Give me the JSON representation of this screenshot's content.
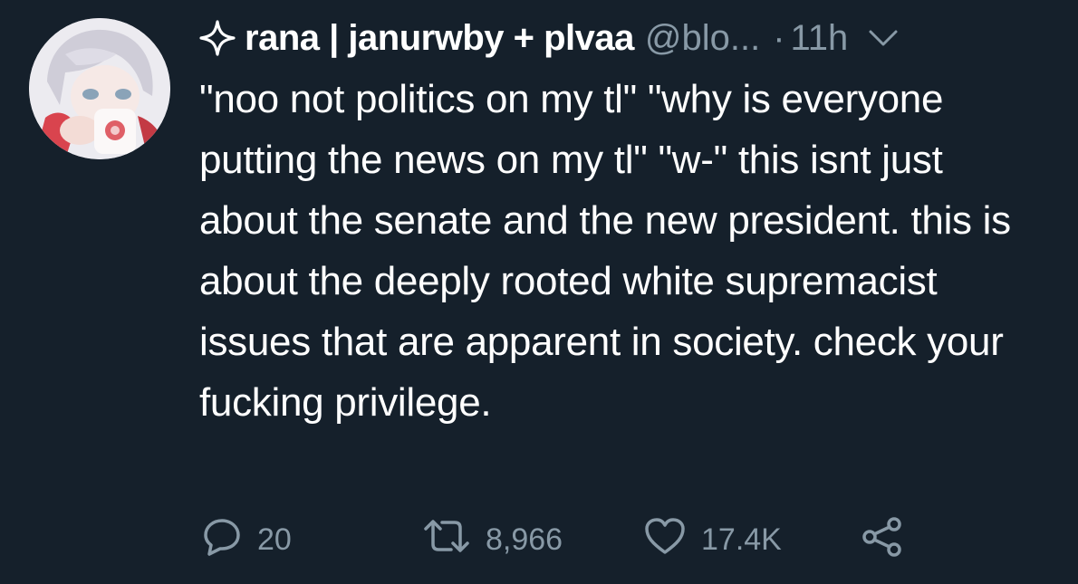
{
  "tweet": {
    "display_name": "rana | janurwby + plvaa",
    "handle": "@blo...",
    "separator": "·",
    "time": "11h",
    "text": "\"noo not politics on my tl\" \"why is everyone putting the news on my tl\" \"w-\" this isnt just about the senate and the new president. this is about the deeply rooted white supremacist issues that are apparent in society. check your fucking privilege.",
    "icons": {
      "name_prefix": "sparkle-icon",
      "menu": "chevron-down-icon",
      "reply": "reply-icon",
      "retweet": "retweet-icon",
      "like": "heart-icon",
      "share": "share-icon"
    }
  },
  "actions": {
    "replies": "20",
    "retweets": "8,966",
    "likes": "17.4K"
  },
  "colors": {
    "background": "#15202b",
    "text_primary": "#ffffff",
    "text_secondary": "#8899a6"
  }
}
